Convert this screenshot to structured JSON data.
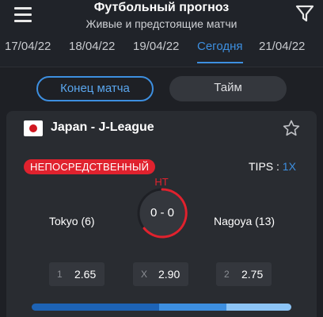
{
  "header": {
    "title": "Футбольный прогноз",
    "subtitle": "Живые и предстоящие матчи",
    "menu_icon": "hamburger-menu-icon",
    "filter_icon": "filter-funnel-icon"
  },
  "date_tabs": [
    {
      "label": "17/04/22",
      "active": false
    },
    {
      "label": "18/04/22",
      "active": false
    },
    {
      "label": "19/04/22",
      "active": false
    },
    {
      "label": "Сегодня",
      "active": true
    },
    {
      "label": "21/04/22",
      "active": false
    }
  ],
  "segment": {
    "end_of_match": "Конец матча",
    "half": "Тайм",
    "selected": "end_of_match"
  },
  "match": {
    "league": "Japan - J-League",
    "country_flag": "japan-flag-icon",
    "favorite_icon": "star-outline-icon",
    "status_badge": "НЕПОСРЕДСТВЕННЫЙ",
    "tips_label": "TIPS :",
    "tips_value": "1X",
    "period": "HT",
    "home_team": "Tokyo (6)",
    "away_team": "Nagoya (13)",
    "score": "0 - 0",
    "odds": [
      {
        "label": "1",
        "value": "2.65"
      },
      {
        "label": "X",
        "value": "2.90"
      },
      {
        "label": "2",
        "value": "2.75"
      }
    ],
    "probability_fractions": [
      0.49,
      0.26,
      0.25
    ]
  },
  "colors": {
    "accent": "#3d8fe0",
    "live": "#e0222e",
    "background": "#1e2025",
    "card": "#292c31"
  }
}
